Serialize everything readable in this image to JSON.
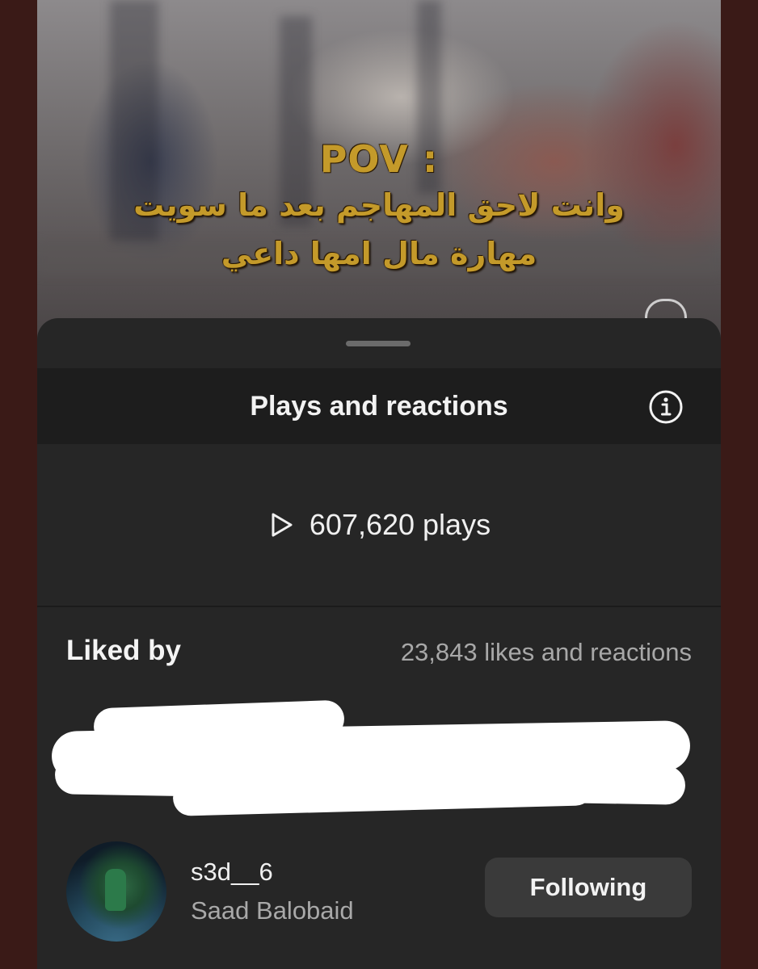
{
  "video": {
    "overlay_title": "POV :",
    "overlay_line1": "وانت لاحق المهاجم بعد ما سويت",
    "overlay_line2": "مهارة مال امها داعي",
    "icons": [
      "heart-icon"
    ]
  },
  "sheet": {
    "title": "Plays and reactions",
    "info_icon": "info-icon",
    "plays": {
      "icon": "play-icon",
      "text": "607,620 plays"
    },
    "liked_by": {
      "label": "Liked by",
      "count_text": "23,843 likes and reactions"
    },
    "users": [
      {
        "username": "s3d__6",
        "full_name": "Saad Balobaid",
        "button_label": "Following"
      }
    ]
  },
  "colors": {
    "overlay_text": "#c49a2a",
    "sheet_background": "#262626",
    "header_background": "#1d1d1d",
    "button_background": "#3a3a3a",
    "outer_border": "#3a1a17"
  }
}
